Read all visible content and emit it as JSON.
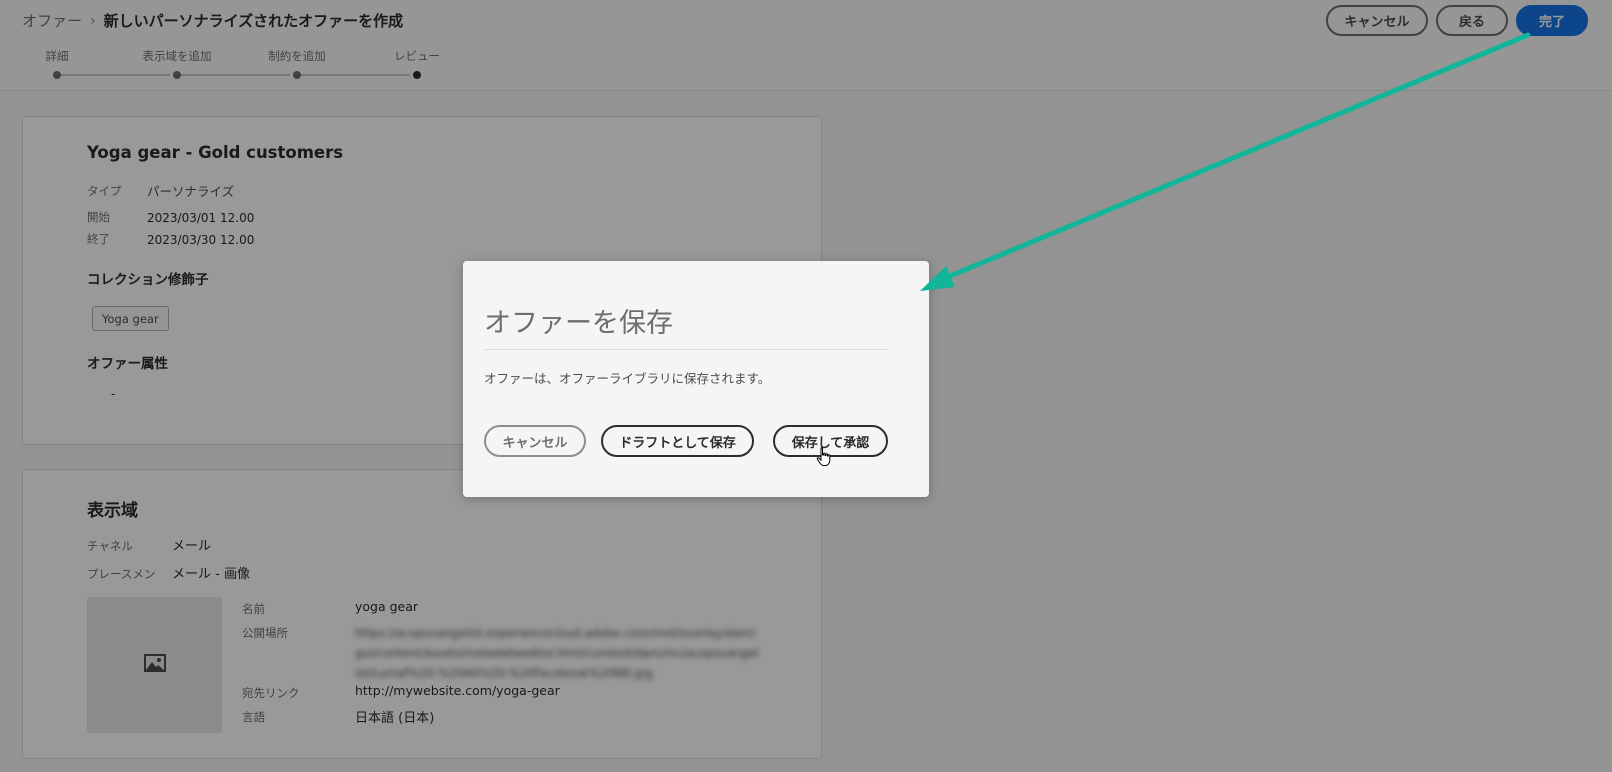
{
  "header": {
    "breadcrumb_parent": "オファー",
    "breadcrumb_separator": "›",
    "breadcrumb_current": "新しいパーソナライズされたオファーを作成",
    "steps": [
      "詳細",
      "表示域を追加",
      "制約を追加",
      "レビュー"
    ],
    "cancel_label": "キャンセル",
    "back_label": "戻る",
    "finish_label": "完了"
  },
  "offer": {
    "title": "Yoga gear - Gold customers",
    "type_label": "タイプ",
    "type_value": "パーソナライズ",
    "start_label": "開始",
    "start_value": "2023/03/01 12.00",
    "end_label": "終了",
    "end_value": "2023/03/30 12.00",
    "collection_heading": "コレクション修飾子",
    "tag": "Yoga gear",
    "attributes_heading": "オファー属性",
    "attributes_value": "-"
  },
  "representation": {
    "title": "表示域",
    "channel_label": "チャネル",
    "channel_value": "メール",
    "placement_label": "プレースメン",
    "placement_value": "メール - 画像",
    "name_label": "名前",
    "name_value": "yoga gear",
    "public_location_label": "公開場所",
    "public_location_value": "https://acopsvangelist.experiencecloud.adobe.com/mnt/overlay/dam/gui/content/assets/metadataeditor.html/content/dam/mc/acopsvangelist/Lumaf%20-%20Alt%20-%20Facebook%20ND.jpg",
    "dest_link_label": "宛先リンク",
    "dest_link_value": "http://mywebsite.com/yoga-gear",
    "language_label": "言語",
    "language_value": "日本語 (日本)"
  },
  "dialog": {
    "title": "オファーを保存",
    "body": "オファーは、オファーライブラリに保存されます。",
    "cancel_label": "キャンセル",
    "save_draft_label": "ドラフトとして保存",
    "save_approve_label": "保存して承認"
  },
  "colors": {
    "accent_blue": "#1473e6",
    "annotation_arrow": "#11b59a"
  },
  "icons": [
    "chevron-right-icon",
    "image-placeholder-icon",
    "hand-pointer-icon",
    "annotation-arrow"
  ]
}
